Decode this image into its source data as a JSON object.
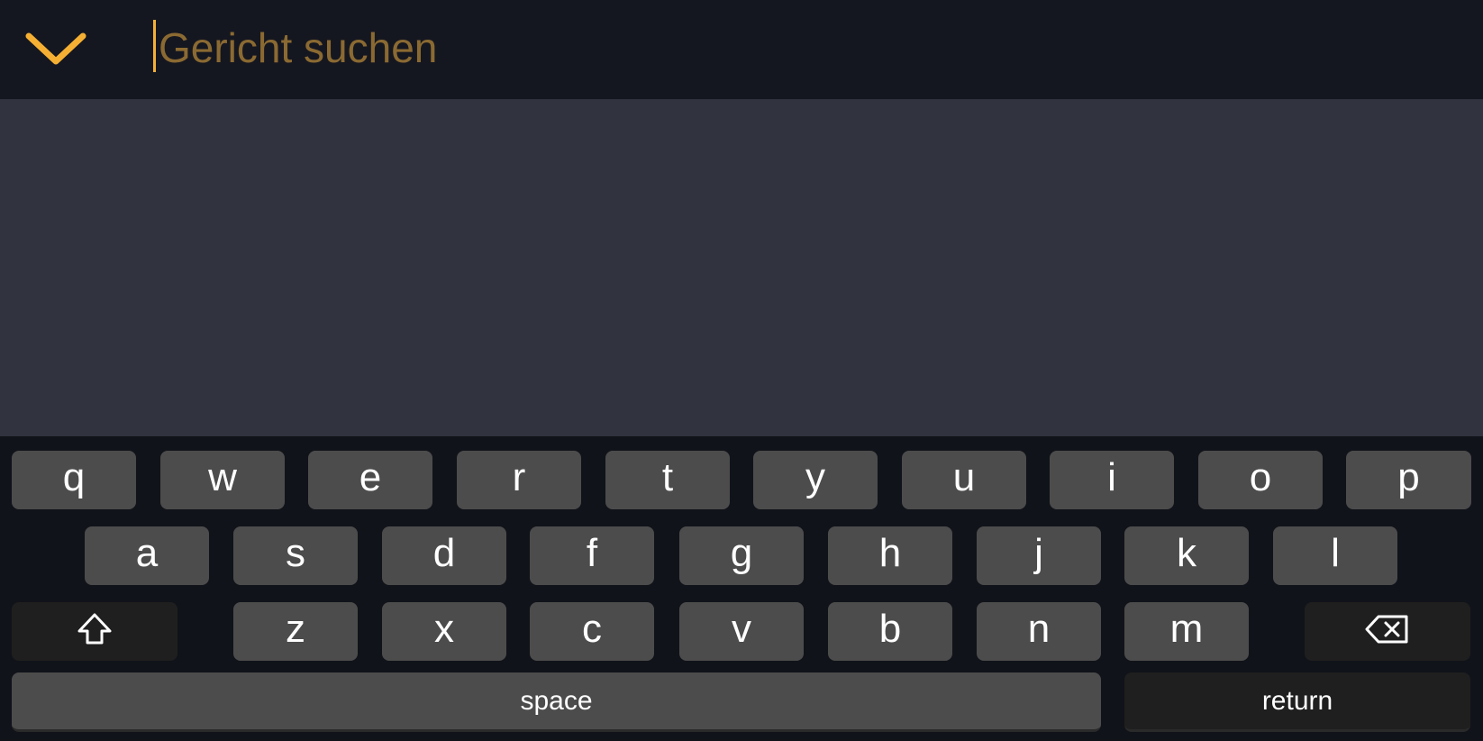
{
  "search": {
    "placeholder": "Gericht suchen",
    "value": ""
  },
  "keyboard": {
    "row1": [
      "q",
      "w",
      "e",
      "r",
      "t",
      "y",
      "u",
      "i",
      "o",
      "p"
    ],
    "row2": [
      "a",
      "s",
      "d",
      "f",
      "g",
      "h",
      "j",
      "k",
      "l"
    ],
    "row3": [
      "z",
      "x",
      "c",
      "v",
      "b",
      "n",
      "m"
    ],
    "space_label": "space",
    "return_label": "return",
    "shift_icon": "shift-arrow-up-icon",
    "backspace_icon": "backspace-icon"
  },
  "icons": {
    "collapse": "chevron-down-icon"
  },
  "colors": {
    "accent": "#F5B033",
    "placeholder": "#8B6A32",
    "topbar_bg": "#151720",
    "content_bg": "#31343F",
    "keyboard_bg": "#11131A",
    "key_bg": "#4C4C4C",
    "key_dark_bg": "#1F1F1F"
  }
}
